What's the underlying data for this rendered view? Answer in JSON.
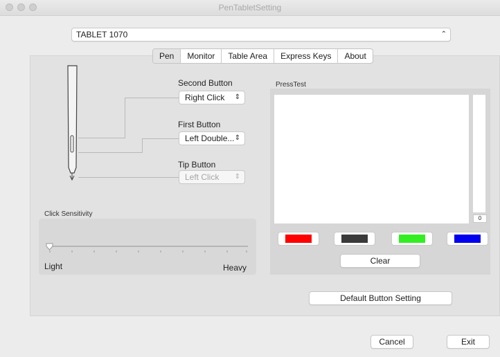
{
  "window": {
    "title": "PenTabletSetting"
  },
  "device": {
    "selected": "TABLET 1070"
  },
  "tabs": [
    "Pen",
    "Monitor",
    "Table Area",
    "Express Keys",
    "About"
  ],
  "pen": {
    "second_button": {
      "label": "Second Button",
      "value": "Right Click"
    },
    "first_button": {
      "label": "First Button",
      "value": "Left Double..."
    },
    "tip_button": {
      "label": "Tip Button",
      "value": "Left Click"
    }
  },
  "sensitivity": {
    "label": "Click Sensitivity",
    "min_label": "Light",
    "max_label": "Heavy",
    "level": 0
  },
  "press_test": {
    "label": "PressTest",
    "pressure_value": "0",
    "colors": [
      "#ff0000",
      "#3a3a3a",
      "#33ee22",
      "#0000ee"
    ],
    "clear_label": "Clear"
  },
  "default_button_label": "Default  Button Setting",
  "cancel_label": "Cancel",
  "exit_label": "Exit",
  "icons": {
    "dropdown": "chevron-updown-icon",
    "pen": "pen-icon"
  }
}
